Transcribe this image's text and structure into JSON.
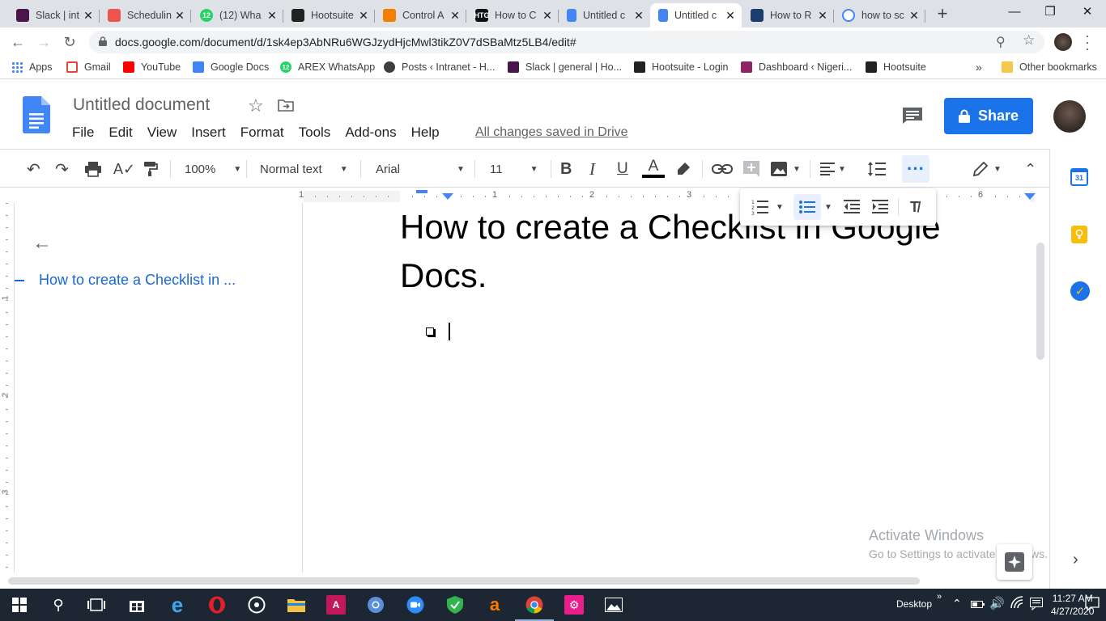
{
  "browser": {
    "tabs": [
      {
        "label": "Slack | int",
        "icon": "slack-icon",
        "color": "#4a154b"
      },
      {
        "label": "Schedulin",
        "icon": "spiral-icon",
        "color": "#ef5350"
      },
      {
        "label": "(12) Wha",
        "icon": "whatsapp-icon",
        "color": "#25d366",
        "badge": "12"
      },
      {
        "label": "Hootsuite",
        "icon": "owl-icon",
        "color": "#222222"
      },
      {
        "label": "Control A",
        "icon": "blogger-icon",
        "color": "#f57d00"
      },
      {
        "label": "How to C",
        "icon": "htg-icon",
        "color": "#111111",
        "badge": "HTG"
      },
      {
        "label": "Untitled c",
        "icon": "docs-icon",
        "color": "#4285f4"
      },
      {
        "label": "Untitled c",
        "icon": "docs-icon",
        "color": "#4285f4"
      },
      {
        "label": "How to R",
        "icon": "generic-site-icon",
        "color": "#1a3c6e"
      },
      {
        "label": "how to sc",
        "icon": "google-icon",
        "color": "#4285f4"
      }
    ],
    "active_tab_index": 7,
    "url": "docs.google.com/document/d/1sk4ep3AbNRu6WGJzydHjcMwl3tikZ0V7dSBaMtz5LB4/edit#",
    "bookmarks": [
      {
        "label": "Apps",
        "icon": "apps-grid-icon"
      },
      {
        "label": "Gmail",
        "icon": "gmail-icon"
      },
      {
        "label": "YouTube",
        "icon": "youtube-icon"
      },
      {
        "label": "Google Docs",
        "icon": "docs-icon"
      },
      {
        "label": "AREX WhatsApp",
        "icon": "whatsapp-icon",
        "badge": "12"
      },
      {
        "label": "Posts ‹ Intranet - H...",
        "icon": "wordpress-icon"
      },
      {
        "label": "Slack | general | Ho...",
        "icon": "slack-icon"
      },
      {
        "label": "Hootsuite - Login",
        "icon": "owl-icon"
      },
      {
        "label": "Dashboard ‹ Nigeri...",
        "icon": "dashboard-icon"
      },
      {
        "label": "Hootsuite",
        "icon": "owl-icon"
      }
    ],
    "other_bookmarks": "Other bookmarks",
    "overflow": "»"
  },
  "docs": {
    "title": "Untitled document",
    "menus": [
      "File",
      "Edit",
      "View",
      "Insert",
      "Format",
      "Tools",
      "Add-ons",
      "Help"
    ],
    "saved_status": "All changes saved in Drive",
    "share_label": "Share",
    "toolbar": {
      "zoom": "100%",
      "style": "Normal text",
      "font": "Arial",
      "size": "11"
    },
    "ruler_numbers": [
      "1",
      "1",
      "2",
      "3",
      "6"
    ],
    "outline": {
      "item": "How to create a Checklist in ..."
    },
    "heading": "How to create a Checklist in Google Docs.",
    "vertical_ruler": [
      "1",
      "2",
      "3"
    ]
  },
  "watermark": {
    "title": "Activate Windows",
    "subtitle": "Go to Settings to activate Windows."
  },
  "taskbar": {
    "desktop_label": "Desktop",
    "time": "11:27 AM",
    "date": "4/27/2020"
  }
}
